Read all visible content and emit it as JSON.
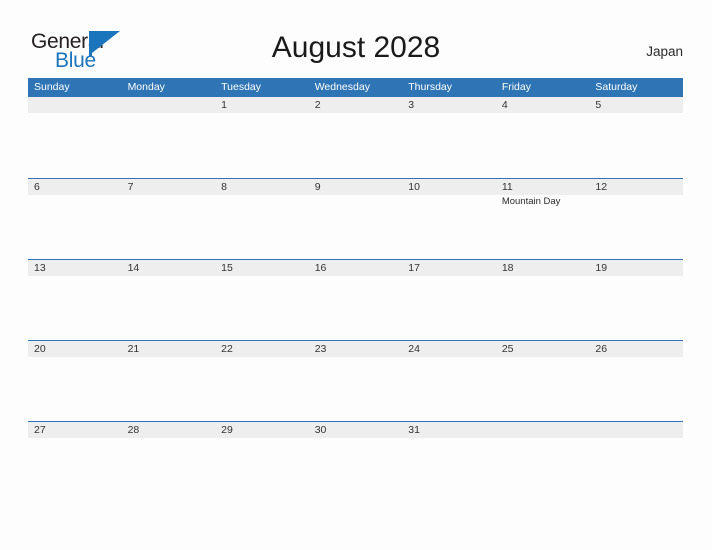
{
  "brand": {
    "name_part1": "General",
    "name_part2": "Blue",
    "accent_color": "#1b75bc"
  },
  "header": {
    "title": "August 2028",
    "country": "Japan"
  },
  "calendar": {
    "header_bg": "#2f74b5",
    "band_bg": "#eeeeee",
    "weekdays": [
      "Sunday",
      "Monday",
      "Tuesday",
      "Wednesday",
      "Thursday",
      "Friday",
      "Saturday"
    ],
    "weeks": [
      [
        {
          "day": "",
          "events": []
        },
        {
          "day": "",
          "events": []
        },
        {
          "day": "1",
          "events": []
        },
        {
          "day": "2",
          "events": []
        },
        {
          "day": "3",
          "events": []
        },
        {
          "day": "4",
          "events": []
        },
        {
          "day": "5",
          "events": []
        }
      ],
      [
        {
          "day": "6",
          "events": []
        },
        {
          "day": "7",
          "events": []
        },
        {
          "day": "8",
          "events": []
        },
        {
          "day": "9",
          "events": []
        },
        {
          "day": "10",
          "events": []
        },
        {
          "day": "11",
          "events": [
            "Mountain Day"
          ]
        },
        {
          "day": "12",
          "events": []
        }
      ],
      [
        {
          "day": "13",
          "events": []
        },
        {
          "day": "14",
          "events": []
        },
        {
          "day": "15",
          "events": []
        },
        {
          "day": "16",
          "events": []
        },
        {
          "day": "17",
          "events": []
        },
        {
          "day": "18",
          "events": []
        },
        {
          "day": "19",
          "events": []
        }
      ],
      [
        {
          "day": "20",
          "events": []
        },
        {
          "day": "21",
          "events": []
        },
        {
          "day": "22",
          "events": []
        },
        {
          "day": "23",
          "events": []
        },
        {
          "day": "24",
          "events": []
        },
        {
          "day": "25",
          "events": []
        },
        {
          "day": "26",
          "events": []
        }
      ],
      [
        {
          "day": "27",
          "events": []
        },
        {
          "day": "28",
          "events": []
        },
        {
          "day": "29",
          "events": []
        },
        {
          "day": "30",
          "events": []
        },
        {
          "day": "31",
          "events": []
        },
        {
          "day": "",
          "events": []
        },
        {
          "day": "",
          "events": []
        }
      ]
    ]
  }
}
